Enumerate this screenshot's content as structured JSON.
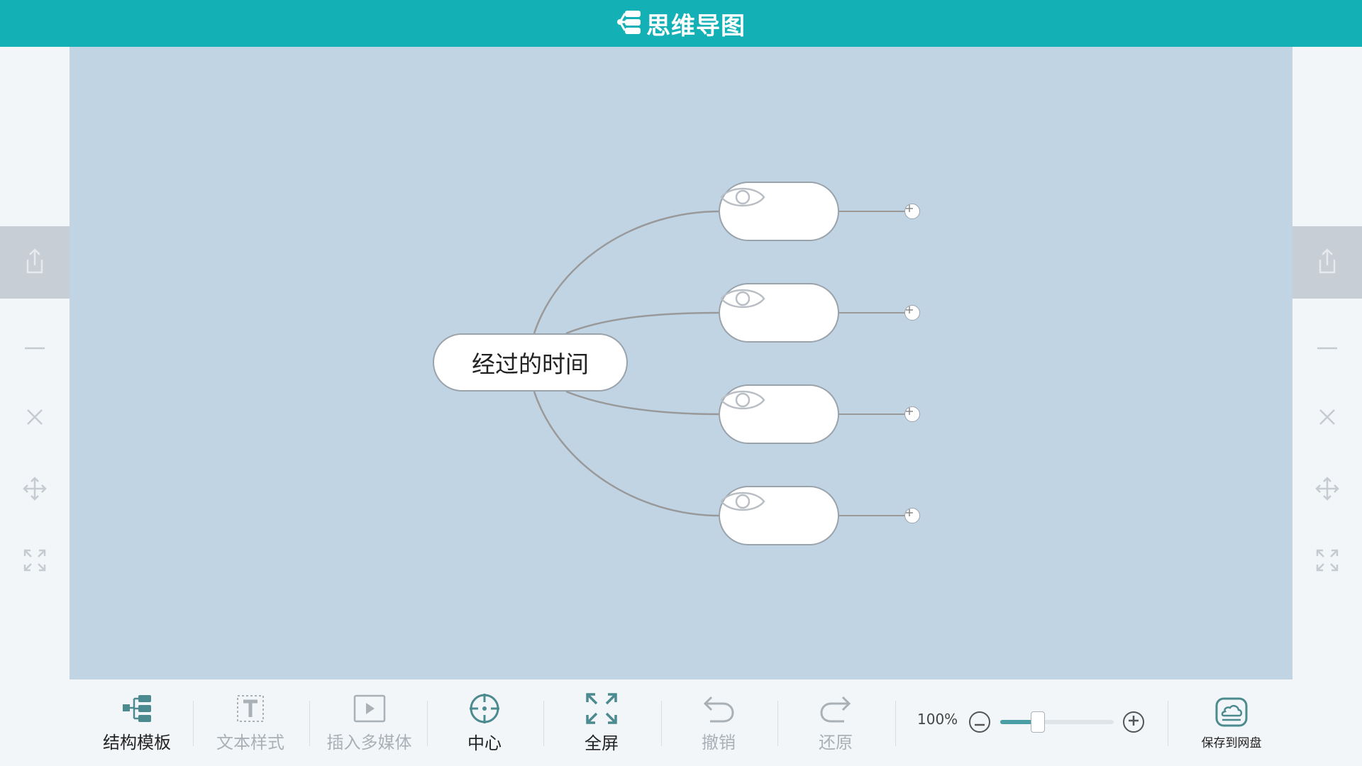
{
  "header": {
    "title": "思维导图",
    "logo_icon": "mindmap-logo-icon",
    "bg_color": "#13b0b6"
  },
  "rails": {
    "buttons": [
      "share-icon",
      "minimize-icon",
      "close-icon",
      "move-icon",
      "expand-icon"
    ]
  },
  "canvas": {
    "bg_color": "#c1d4e4",
    "root": {
      "label": "经过的时间"
    },
    "children": [
      {
        "icon": "eye-icon"
      },
      {
        "icon": "eye-icon"
      },
      {
        "icon": "eye-icon"
      },
      {
        "icon": "eye-icon"
      }
    ]
  },
  "toolbar": {
    "structure_label": "结构模板",
    "text_style_label": "文本样式",
    "insert_media_label": "插入多媒体",
    "center_label": "中心",
    "fullscreen_label": "全屏",
    "undo_label": "撤销",
    "redo_label": "还原",
    "zoom_level": "100%",
    "zoom_slider_fraction": 0.33,
    "save_label": "保存到网盘"
  }
}
